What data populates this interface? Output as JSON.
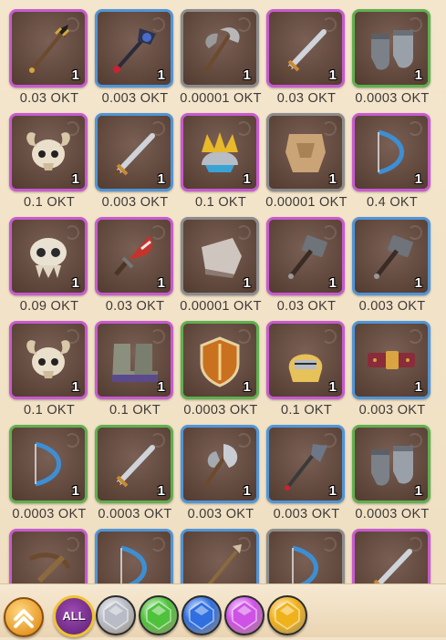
{
  "items": [
    {
      "price": "0.03 OKT",
      "qty": "1",
      "rarity": "purple",
      "icon": "trident-icon"
    },
    {
      "price": "0.003 OKT",
      "qty": "1",
      "rarity": "blue",
      "icon": "battle-scepter-icon"
    },
    {
      "price": "0.00001 OKT",
      "qty": "1",
      "rarity": "gray",
      "icon": "double-axe-icon"
    },
    {
      "price": "0.03 OKT",
      "qty": "1",
      "rarity": "purple",
      "icon": "sword-icon"
    },
    {
      "price": "0.0003 OKT",
      "qty": "1",
      "rarity": "green",
      "icon": "gauntlets-icon"
    },
    {
      "price": "0.1 OKT",
      "qty": "1",
      "rarity": "purple",
      "icon": "ram-skull-helmet-icon"
    },
    {
      "price": "0.003 OKT",
      "qty": "1",
      "rarity": "blue",
      "icon": "sword-icon"
    },
    {
      "price": "0.1 OKT",
      "qty": "1",
      "rarity": "purple",
      "icon": "crown-helmet-icon"
    },
    {
      "price": "0.00001 OKT",
      "qty": "1",
      "rarity": "gray",
      "icon": "cloth-armor-icon"
    },
    {
      "price": "0.4 OKT",
      "qty": "1",
      "rarity": "purple",
      "icon": "bow-icon"
    },
    {
      "price": "0.09 OKT",
      "qty": "1",
      "rarity": "purple",
      "icon": "beast-skull-icon"
    },
    {
      "price": "0.03 OKT",
      "qty": "1",
      "rarity": "purple",
      "icon": "red-dagger-icon"
    },
    {
      "price": "0.00001 OKT",
      "qty": "1",
      "rarity": "gray",
      "icon": "bracer-icon"
    },
    {
      "price": "0.03 OKT",
      "qty": "1",
      "rarity": "purple",
      "icon": "hammer-icon"
    },
    {
      "price": "0.003 OKT",
      "qty": "1",
      "rarity": "blue",
      "icon": "hammer-icon"
    },
    {
      "price": "0.1 OKT",
      "qty": "1",
      "rarity": "purple",
      "icon": "ram-skull-helmet-icon"
    },
    {
      "price": "0.1 OKT",
      "qty": "1",
      "rarity": "purple",
      "icon": "boots-icon"
    },
    {
      "price": "0.0003 OKT",
      "qty": "1",
      "rarity": "green",
      "icon": "shield-icon"
    },
    {
      "price": "0.1 OKT",
      "qty": "1",
      "rarity": "purple",
      "icon": "knight-helmet-icon"
    },
    {
      "price": "0.003 OKT",
      "qty": "1",
      "rarity": "blue",
      "icon": "belt-icon"
    },
    {
      "price": "0.0003 OKT",
      "qty": "1",
      "rarity": "green",
      "icon": "bow-icon"
    },
    {
      "price": "0.0003 OKT",
      "qty": "1",
      "rarity": "green",
      "icon": "sword-icon"
    },
    {
      "price": "0.003 OKT",
      "qty": "1",
      "rarity": "blue",
      "icon": "battle-axe-icon"
    },
    {
      "price": "0.003 OKT",
      "qty": "1",
      "rarity": "blue",
      "icon": "halberd-icon"
    },
    {
      "price": "0.0003 OKT",
      "qty": "1",
      "rarity": "green",
      "icon": "gauntlets-icon"
    },
    {
      "price": "",
      "qty": "",
      "rarity": "purple",
      "icon": "crossbow-icon"
    },
    {
      "price": "",
      "qty": "",
      "rarity": "blue",
      "icon": "bow-icon"
    },
    {
      "price": "",
      "qty": "",
      "rarity": "blue",
      "icon": "spear-icon"
    },
    {
      "price": "",
      "qty": "",
      "rarity": "gray",
      "icon": "bow-icon"
    },
    {
      "price": "",
      "qty": "",
      "rarity": "purple",
      "icon": "sword-icon"
    }
  ],
  "filter_bar": {
    "all_label": "ALL",
    "gems": [
      {
        "icon": "white-gem-icon",
        "color": "#b9bcc6"
      },
      {
        "icon": "green-gem-icon",
        "color": "#4fc23c"
      },
      {
        "icon": "blue-gem-icon",
        "color": "#2f6fe0"
      },
      {
        "icon": "purple-gem-icon",
        "color": "#cf52e6"
      },
      {
        "icon": "gold-gem-icon",
        "color": "#f0b21b"
      }
    ]
  }
}
